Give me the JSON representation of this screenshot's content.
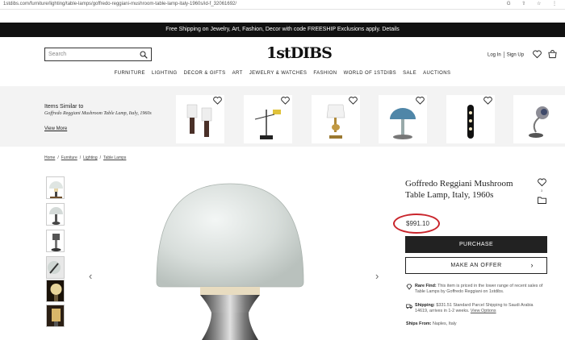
{
  "browser": {
    "url": "1stdibs.com/furniture/lighting/table-lamps/goffredo-reggiani-mushroom-table-lamp-italy-1960s/id-f_32061692/",
    "icons": [
      "google-icon",
      "share-icon",
      "star-icon",
      "menu-icon"
    ],
    "icon_glyphs": "G ⇧ ☆ ⋮"
  },
  "promo": {
    "text": "Free Shipping on Jewelry, Art, Fashion, Decor with code FREESHIP Exclusions apply. Details"
  },
  "header": {
    "search_placeholder": "Search",
    "logo": "1stDIBS",
    "login": "Log In",
    "signup": "Sign Up"
  },
  "nav": {
    "items": [
      "FURNITURE",
      "LIGHTING",
      "DECOR & GIFTS",
      "ART",
      "JEWELRY & WATCHES",
      "FASHION",
      "WORLD OF 1STDIBS",
      "SALE",
      "AUCTIONS"
    ]
  },
  "similar": {
    "heading": "Items Similar to",
    "subheading": "Goffredo Reggiani Mushroom Table Lamp, Italy, 1960s",
    "view_more": "View More"
  },
  "breadcrumb": [
    "Home",
    "Furniture",
    "Lighting",
    "Table Lamps"
  ],
  "product": {
    "title": "Goffredo Reggiani Mushroom Table Lamp, Italy, 1960s",
    "price": "$991.10",
    "favorite_count": "3",
    "purchase_label": "PURCHASE",
    "offer_label": "MAKE AN OFFER",
    "rare_find_label": "Rare Find:",
    "rare_find_text": "This item is priced in the lower range of recent sales of Table Lamps by Goffredo Reggiani on 1stdibs.",
    "shipping_label": "Shipping:",
    "shipping_text": "$331.51 Standard Parcel Shipping to Saudi Arabia 14619, arrives in 1-2 weeks.",
    "shipping_link": "View Options",
    "ships_from_label": "Ships From:",
    "ships_from_text": "Naples, Italy"
  },
  "colors": {
    "accent": "#222222",
    "highlight_circle": "#c9252c",
    "strip_bg": "#f3f3f3"
  }
}
